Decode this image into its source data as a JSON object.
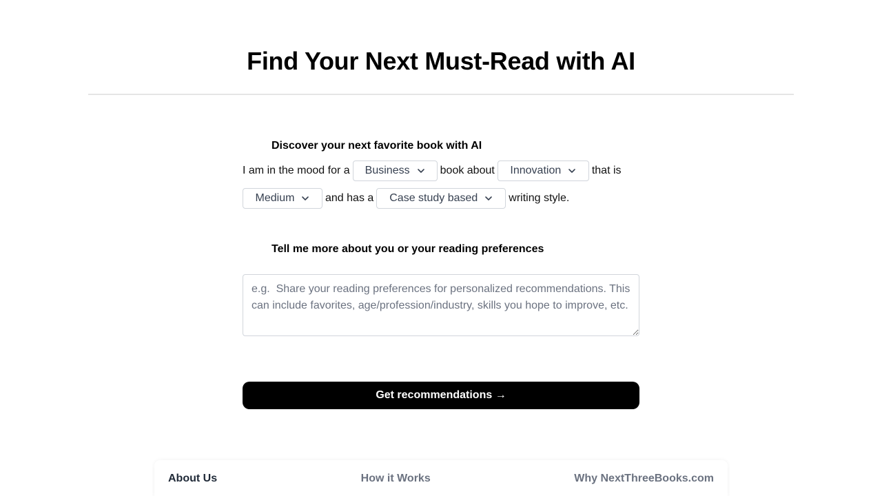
{
  "header": {
    "title": "Find Your Next Must-Read with AI"
  },
  "discover": {
    "label": "Discover your next favorite book with AI",
    "sentence": {
      "part1": "I am in the mood for a",
      "part2": "book about",
      "part3": "that is",
      "part4": "and has a",
      "part5": "writing style."
    },
    "selects": {
      "genre": "Business",
      "topic": "Innovation",
      "length": "Medium",
      "style": "Case study based"
    }
  },
  "preferences": {
    "label": "Tell me more about you or your reading preferences",
    "placeholder": "e.g.  Share your reading preferences for personalized recommendations. This can include favorites, age/profession/industry, skills you hope to improve, etc."
  },
  "cta": {
    "label": "Get recommendations →"
  },
  "footer": {
    "links": [
      "About Us",
      "How it Works",
      "Why NextThreeBooks.com"
    ]
  },
  "colors": {
    "button_bg": "#000000",
    "button_text": "#ffffff",
    "select_border": "#d1d5db",
    "muted_text": "#6b7280"
  },
  "icons": {
    "select_indicator": "chevron-down-icon"
  }
}
